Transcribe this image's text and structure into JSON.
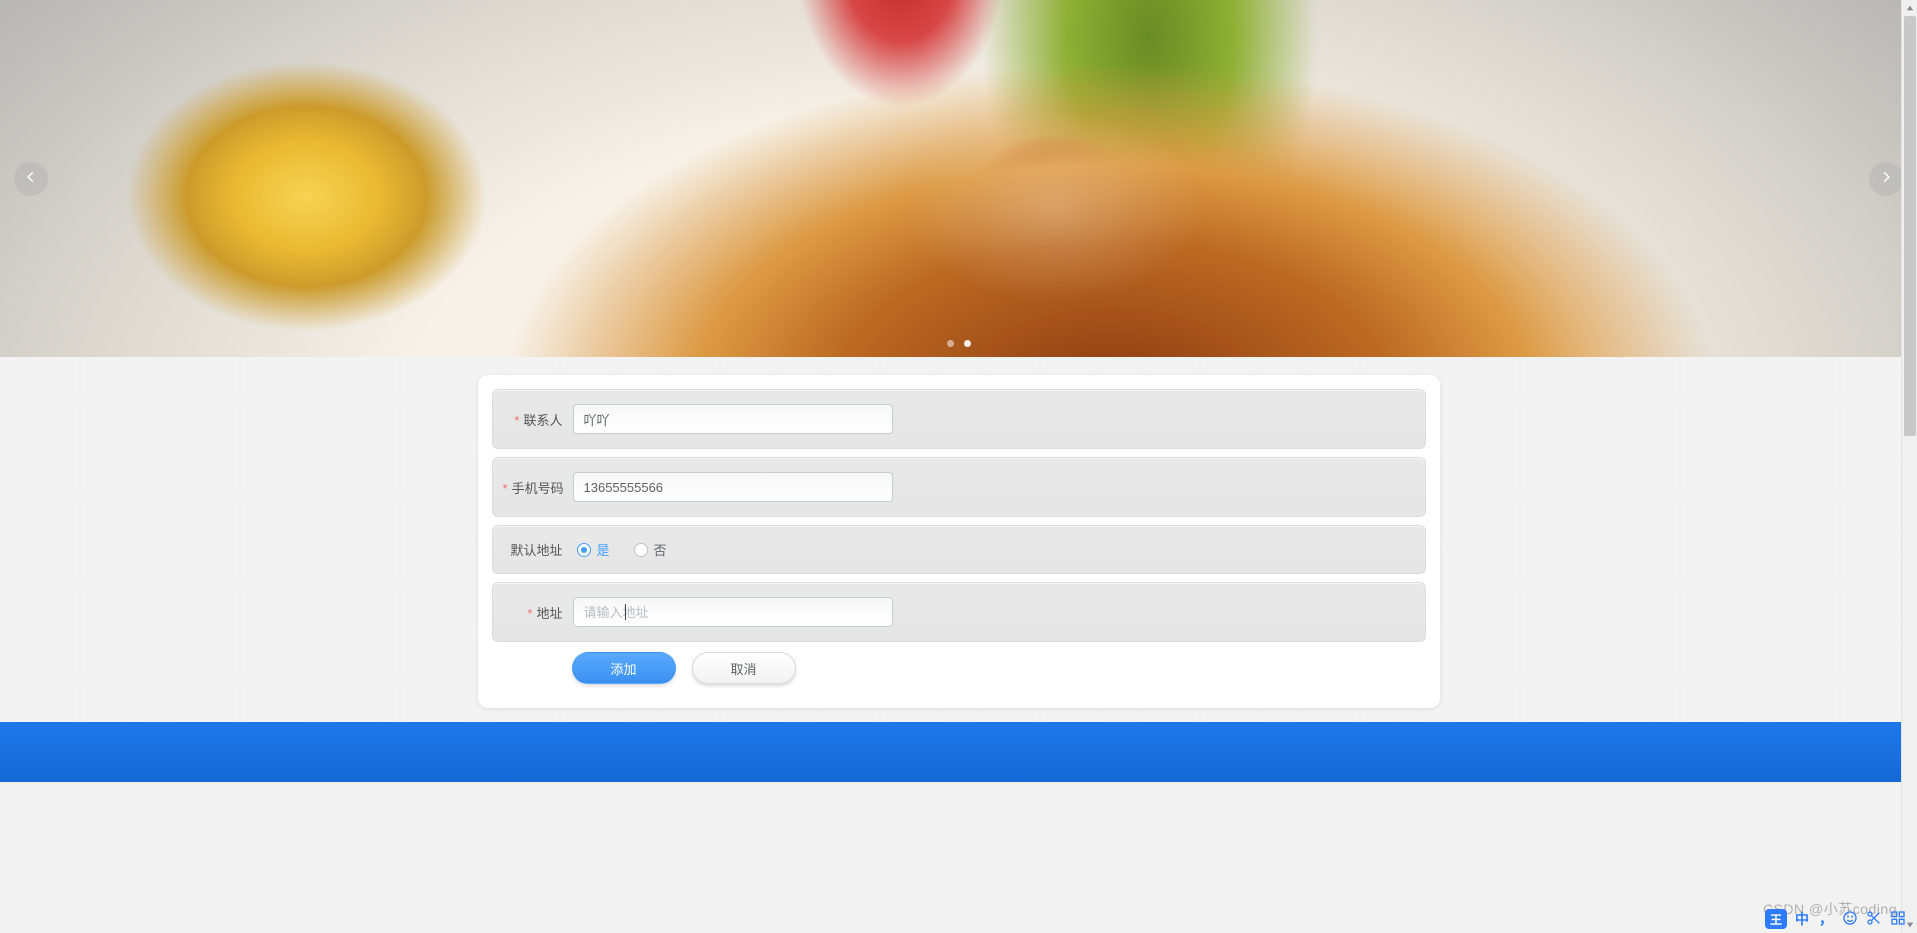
{
  "carousel": {
    "prev_icon": "chevron-left",
    "next_icon": "chevron-right",
    "active_dot": 1,
    "dot_count": 2
  },
  "form": {
    "contact": {
      "label": "联系人",
      "value": "吖吖",
      "required": true
    },
    "phone": {
      "label": "手机号码",
      "value": "13655555566",
      "required": true
    },
    "default_addr": {
      "label": "默认地址",
      "options": {
        "yes": "是",
        "no": "否"
      },
      "selected": "yes"
    },
    "address": {
      "label": "地址",
      "value": "",
      "placeholder": "请输入地址",
      "required": true
    },
    "buttons": {
      "submit": "添加",
      "cancel": "取消"
    }
  },
  "watermark": "CSDN @小苏coding",
  "ime": {
    "badge": "王",
    "lang": "中",
    "punct": "，",
    "emoji_icon": "smile",
    "scissors_icon": "scissors",
    "grid_icon": "grid"
  }
}
